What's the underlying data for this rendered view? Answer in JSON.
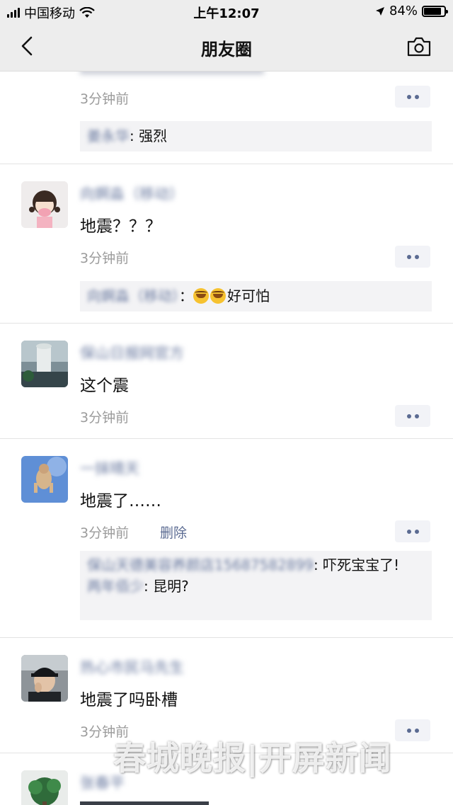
{
  "status_bar": {
    "carrier": "中国移动",
    "time": "上午12:07",
    "battery": "84%",
    "battery_level": 0.84
  },
  "nav": {
    "title": "朋友圈",
    "back_icon": "chevron-left-icon",
    "camera_icon": "camera-icon"
  },
  "posts": [
    {
      "time": "3分钟前",
      "comments": [
        {
          "name": "姜永华",
          "text": ": 强烈"
        }
      ]
    },
    {
      "name": "向婀淼（移动）",
      "content": "地震？？？",
      "time": "3分钟前",
      "comments": [
        {
          "name": "向婀淼（移动）",
          "text": "好可怕"
        }
      ]
    },
    {
      "name": "保山日报网官方",
      "content": "这个震",
      "time": "3分钟前"
    },
    {
      "name": "一抹晴天",
      "content": "地震了……",
      "time": "3分钟前",
      "delete_label": "删除",
      "comments": [
        {
          "name": "保山天德美容养颜店15687582899",
          "text": ": 吓死宝宝了!"
        },
        {
          "name": "两年佰少",
          "text": ": 昆明?"
        }
      ]
    },
    {
      "name": "热心市民马先生",
      "content": "地震了吗卧槽",
      "time": "3分钟前"
    },
    {
      "name": "张春平"
    }
  ],
  "watermark": "春城晚报|开屏新闻",
  "colors": {
    "link_blue": "#5b6b92",
    "nav_bg": "#ededed",
    "comment_bg": "#f3f3f5"
  }
}
